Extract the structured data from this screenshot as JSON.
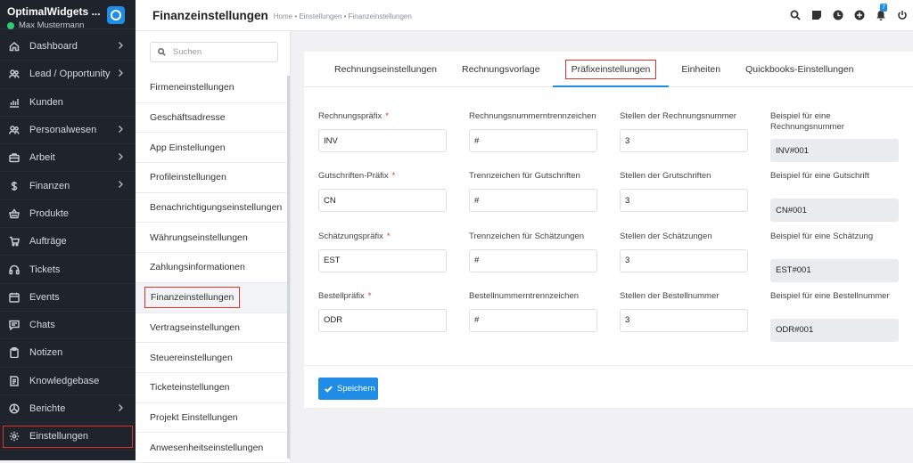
{
  "brand": {
    "title": "OptimalWidgets ...",
    "user": "Max Mustermann"
  },
  "nav": [
    {
      "label": "Dashboard",
      "icon": "home-icon",
      "arrow": true
    },
    {
      "label": "Lead / Opportunity",
      "icon": "users-icon",
      "arrow": true
    },
    {
      "label": "Kunden",
      "icon": "chart-icon",
      "arrow": false
    },
    {
      "label": "Personalwesen",
      "icon": "people-icon",
      "arrow": true
    },
    {
      "label": "Arbeit",
      "icon": "briefcase-icon",
      "arrow": true
    },
    {
      "label": "Finanzen",
      "icon": "dollar-icon",
      "arrow": true
    },
    {
      "label": "Produkte",
      "icon": "basket-icon",
      "arrow": false
    },
    {
      "label": "Aufträge",
      "icon": "cart-icon",
      "arrow": false
    },
    {
      "label": "Tickets",
      "icon": "headset-icon",
      "arrow": false
    },
    {
      "label": "Events",
      "icon": "calendar-icon",
      "arrow": false
    },
    {
      "label": "Chats",
      "icon": "chat-icon",
      "arrow": false
    },
    {
      "label": "Notizen",
      "icon": "clipboard-icon",
      "arrow": false
    },
    {
      "label": "Knowledgebase",
      "icon": "book-icon",
      "arrow": false
    },
    {
      "label": "Berichte",
      "icon": "pie-chart-icon",
      "arrow": true
    },
    {
      "label": "Einstellungen",
      "icon": "gear-icon",
      "arrow": false,
      "active": true
    }
  ],
  "header": {
    "title": "Finanzeinstellungen",
    "breadcrumb": "Home • Einstellungen • Finanzeinstellungen",
    "notification_count": "7"
  },
  "settings_menu": {
    "search_placeholder": "Suchen",
    "items": [
      "Firmeneinstellungen",
      "Geschäftsadresse",
      "App Einstellungen",
      "Profileinstellungen",
      "Benachrichtigungseinstellungen",
      "Währungseinstellungen",
      "Zahlungsinformationen",
      "Finanzeinstellungen",
      "Vertragseinstellungen",
      "Steuereinstellungen",
      "Ticketeinstellungen",
      "Projekt Einstellungen",
      "Anwesenheitseinstellungen"
    ],
    "active_index": 7
  },
  "tabs": [
    "Rechnungseinstellungen",
    "Rechnungsvorlage",
    "Präfixeinstellungen",
    "Einheiten",
    "Quickbooks-Einstellungen"
  ],
  "active_tab": 2,
  "form_rows": [
    {
      "prefix_label": "Rechnungspräfix",
      "prefix": "INV",
      "sep_label": "Rechnungsnummerntrennzeichen",
      "sep": "#",
      "digits_label": "Stellen der Rechnungsnummer",
      "digits": "3",
      "example_label": "Beispiel für eine Rechnungsnummer",
      "example": "INV#001"
    },
    {
      "prefix_label": "Gutschriften-Präfix",
      "prefix": "CN",
      "sep_label": "Trennzeichen für Gutschriften",
      "sep": "#",
      "digits_label": "Stellen der Grutschriften",
      "digits": "3",
      "example_label": "Beispiel für eine Gutschrift",
      "example": "CN#001"
    },
    {
      "prefix_label": "Schätzungspräfix",
      "prefix": "EST",
      "sep_label": "Trennzeichen für Schätzungen",
      "sep": "#",
      "digits_label": "Stellen der Schätzungen",
      "digits": "3",
      "example_label": "Beispiel für eine Schätzung",
      "example": "EST#001"
    },
    {
      "prefix_label": "Bestellpräfix",
      "prefix": "ODR",
      "sep_label": "Bestellnummerntrennzeichen",
      "sep": "#",
      "digits_label": "Stellen der Bestellnummer",
      "digits": "3",
      "example_label": "Beispiel für eine Bestellnummer",
      "example": "ODR#001"
    }
  ],
  "required_mark": "*",
  "save_label": "Speichern",
  "colors": {
    "accent": "#1f8ce6",
    "sidebar": "#1f232b",
    "highlight": "#e0322b"
  }
}
